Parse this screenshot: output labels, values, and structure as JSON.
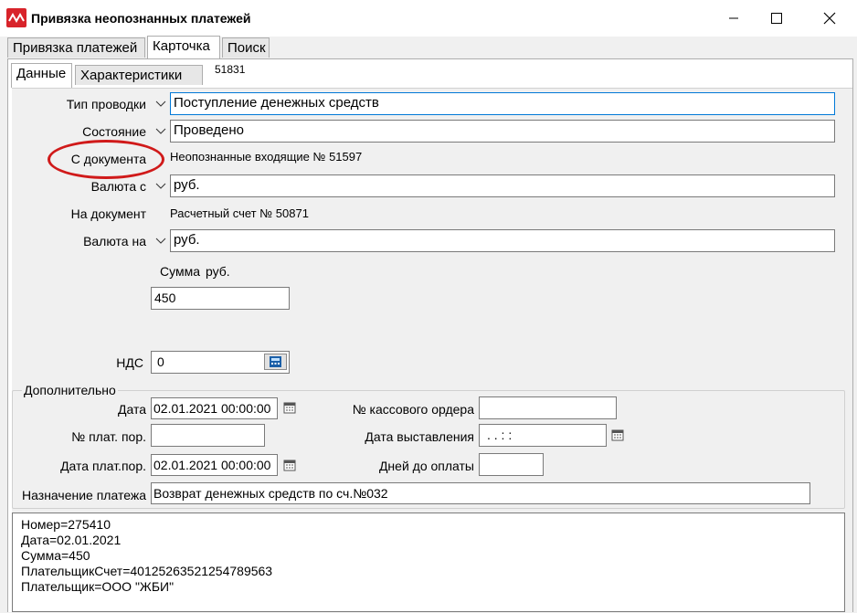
{
  "window": {
    "title": "Привязка неопознанных платежей"
  },
  "tabs_top": [
    "Привязка платежей",
    "Карточка",
    "Поиск"
  ],
  "tabs_card": [
    "Данные",
    "Характеристики"
  ],
  "doc_id": "51831",
  "form": {
    "tip_label": "Тип проводки",
    "tip_value": "Поступление денежных средств",
    "state_label": "Состояние",
    "state_value": "Проведено",
    "from_doc_label": "С документа",
    "from_doc_value": "Неопознанные входящие № 51597",
    "currency_from_label": "Валюта с",
    "currency_from_value": "руб.",
    "to_doc_label": "На документ",
    "to_doc_value": "Расчетный счет № 50871",
    "currency_to_label": "Валюта на",
    "currency_to_value": "руб.",
    "sum_label": "Сумма",
    "sum_currency": "руб.",
    "sum_value": "450",
    "vat_label": "НДС",
    "vat_value": "0"
  },
  "extra": {
    "group_title": "Дополнительно",
    "date_label": "Дата",
    "date_value": "02.01.2021 00:00:00",
    "cash_order_label": "№ кассового ордера",
    "cash_order_value": "",
    "pay_order_num_label": "№ плат. пор.",
    "pay_order_num_value": "",
    "issue_date_label": "Дата выставления",
    "issue_date_value": " .  .      :  :",
    "pay_order_date_label": "Дата плат.пор.",
    "pay_order_date_value": "02.01.2021 00:00:00",
    "days_to_pay_label": "Дней до оплаты",
    "days_to_pay_value": "",
    "purpose_label": "Назначение платежа",
    "purpose_value": "Возврат денежных средств по сч.№032"
  },
  "memo": "Номер=275410\nДата=02.01.2021\nСумма=450\nПлательщикСчет=40125263521254789563\nПлательщик=ООО \"ЖБИ\"",
  "colors": {
    "accent": "#0078d7",
    "annotation": "#d01a1a",
    "app_icon": "#d8232a"
  },
  "icons": {
    "app": "app-logo-icon",
    "calendar": "calendar-icon",
    "calculator": "calculator-icon",
    "dropdown": "chevron-down-icon"
  }
}
